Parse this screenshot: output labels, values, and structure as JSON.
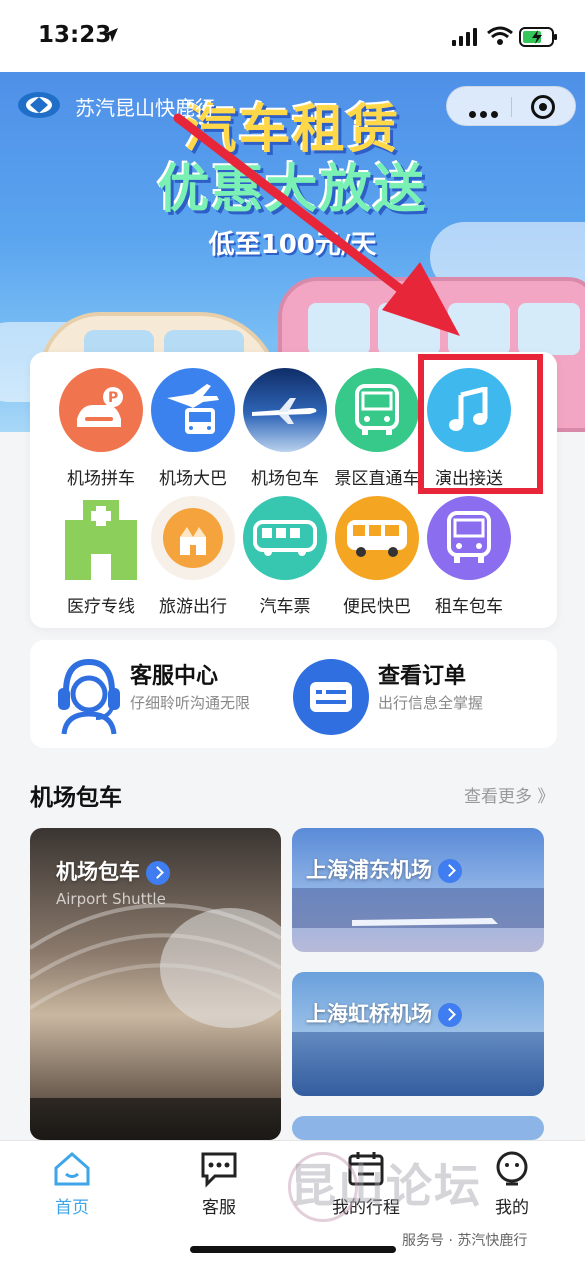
{
  "status_bar": {
    "time": "13:23"
  },
  "mini_program": {
    "title": "苏汽昆山快鹿行"
  },
  "banner": {
    "line1": "汽车租赁",
    "line2": "优惠大放送",
    "line3": "低至100元/天"
  },
  "services": [
    {
      "label": "机场拼车",
      "icon": "carpool-p-icon",
      "color": "#f0744e"
    },
    {
      "label": "机场大巴",
      "icon": "plane-bus-icon",
      "color": "#3c82ee"
    },
    {
      "label": "机场包车",
      "icon": "airplane-photo-icon",
      "color": "#2b5aa8"
    },
    {
      "label": "景区直通车",
      "icon": "bus-icon",
      "color": "#37c98a"
    },
    {
      "label": "演出接送",
      "icon": "music-note-icon",
      "color": "#3fb8ee"
    },
    {
      "label": "医疗专线",
      "icon": "hospital-icon",
      "color": "#8ccf5a"
    },
    {
      "label": "旅游出行",
      "icon": "castle-icon",
      "color": "#f5a33d"
    },
    {
      "label": "汽车票",
      "icon": "coach-icon",
      "color": "#37c7b0"
    },
    {
      "label": "便民快巴",
      "icon": "minibus-icon",
      "color": "#f4a623"
    },
    {
      "label": "租车包车",
      "icon": "rental-bus-icon",
      "color": "#8b6ef0"
    }
  ],
  "quick": {
    "service": {
      "title": "客服中心",
      "subtitle": "仔细聆听沟通无限"
    },
    "orders": {
      "title": "查看订单",
      "subtitle": "出行信息全掌握"
    }
  },
  "section": {
    "title": "机场包车",
    "more": "查看更多 》",
    "main_tile": {
      "title": "机场包车",
      "subtitle": "Airport Shuttle"
    },
    "tiles": [
      {
        "title": "上海浦东机场"
      },
      {
        "title": "上海虹桥机场"
      }
    ]
  },
  "tabs": [
    {
      "label": "首页",
      "active": true
    },
    {
      "label": "客服",
      "active": false
    },
    {
      "label": "我的行程",
      "active": false
    },
    {
      "label": "我的",
      "active": false
    }
  ],
  "watermark": "昆山论坛",
  "footer_note": "服务号 · 苏汽快鹿行"
}
